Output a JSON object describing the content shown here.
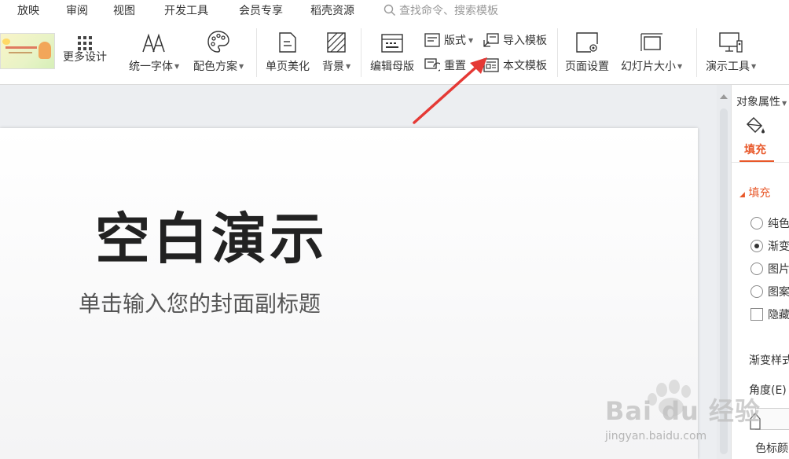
{
  "menu": {
    "items": [
      "放映",
      "审阅",
      "视图",
      "开发工具",
      "会员专享",
      "稻壳资源"
    ],
    "search_placeholder": "查找命令、搜索模板"
  },
  "ribbon": {
    "more_design": "更多设计",
    "unify_font": "统一字体",
    "color_scheme": "配色方案",
    "page_beautify": "单页美化",
    "background": "背景",
    "edit_master": "编辑母版",
    "layout": "版式",
    "reset": "重置",
    "import_template": "导入模板",
    "text_template": "本文模板",
    "page_setup": "页面设置",
    "slide_size": "幻灯片大小",
    "present_tools": "演示工具"
  },
  "slide": {
    "title": "空白演示",
    "subtitle": "单击输入您的封面副标题"
  },
  "panel": {
    "title": "对象属性",
    "tab_fill": "填充",
    "section_fill": "填充",
    "options": [
      "纯色",
      "渐变",
      "图片",
      "图案"
    ],
    "selected_option": "渐变",
    "hide_option": "隐藏",
    "gradient_style": "渐变样式",
    "angle": "角度(E)",
    "color_stop": "色标颜"
  },
  "watermark": {
    "text": "Bai du 经验",
    "url": "jingyan.baidu.com"
  },
  "colors": {
    "accent": "#e8582a",
    "arrow": "#e53935"
  }
}
